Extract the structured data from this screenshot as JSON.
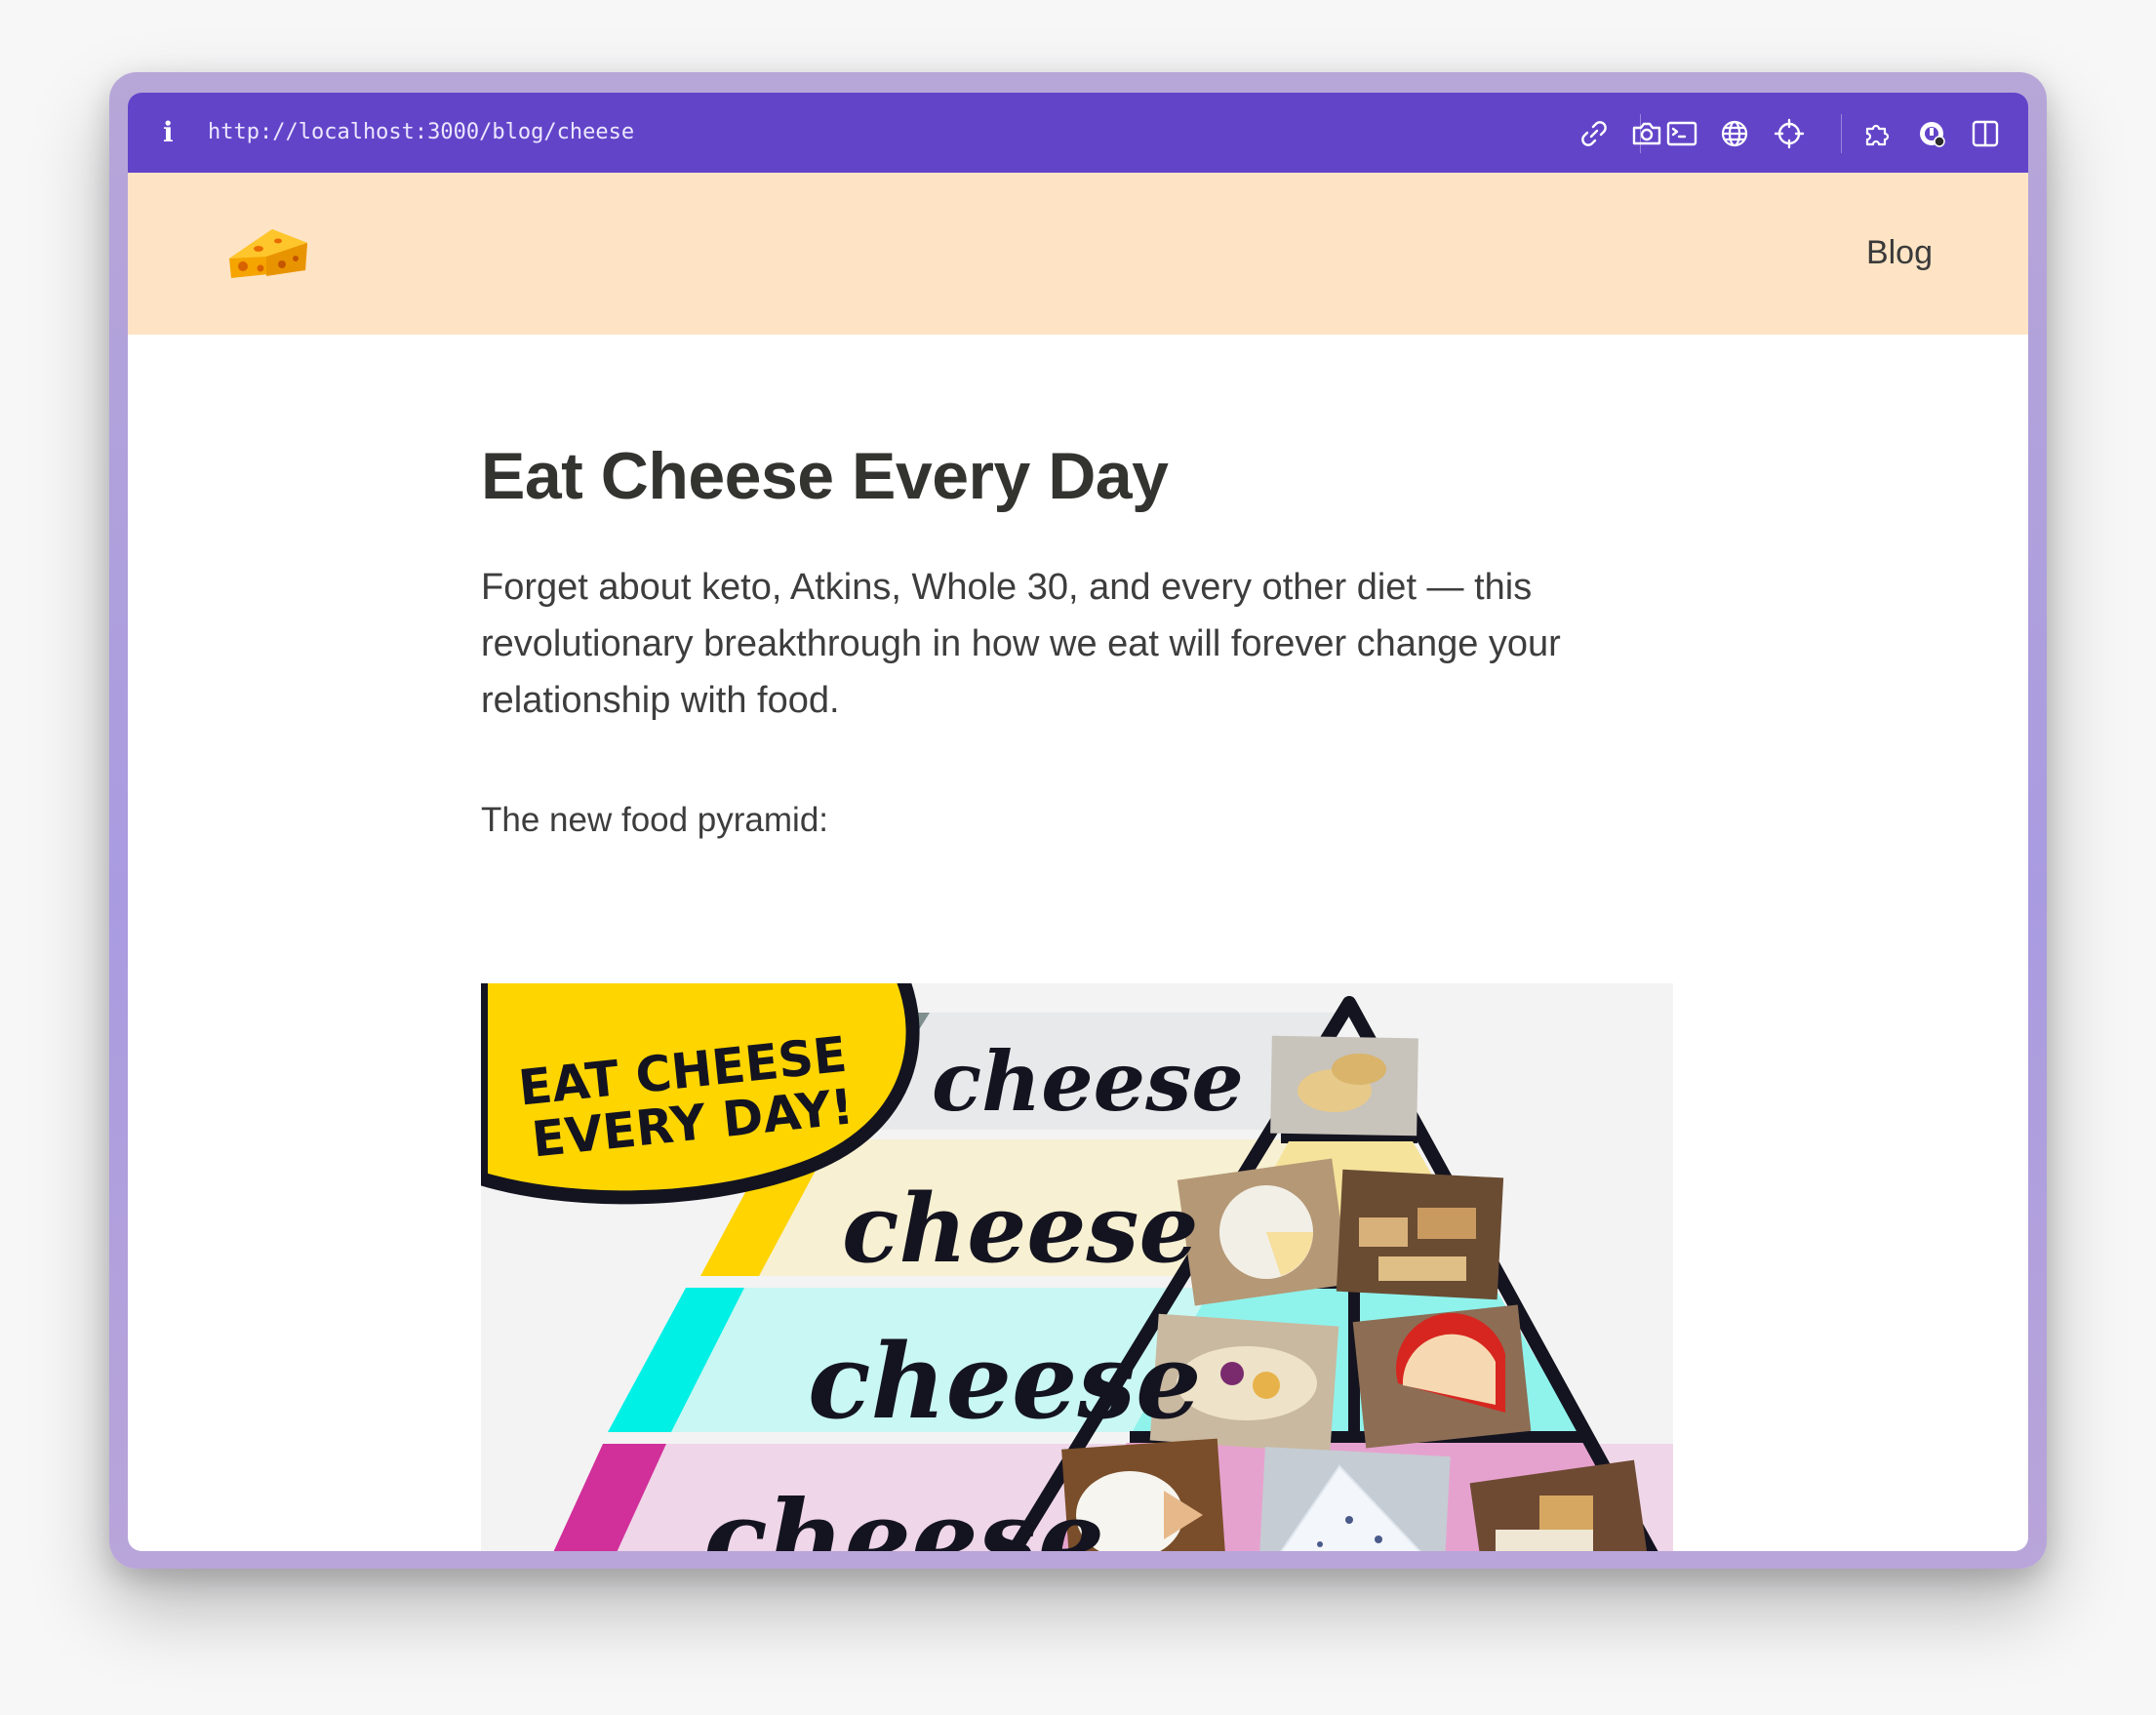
{
  "browser": {
    "url": "http://localhost:3000/blog/cheese",
    "toolbar_icons": [
      "link-icon",
      "camera-icon",
      "terminal-icon",
      "globe-icon",
      "crosshair-icon",
      "extension-icon",
      "devtools-icon",
      "split-view-icon"
    ]
  },
  "site": {
    "logo": "cheese-logo",
    "nav": {
      "blog_label": "Blog"
    }
  },
  "post": {
    "title": "Eat Cheese Every Day",
    "lead": "Forget about keto, Atkins, Whole 30, and every other diet — this revolutionary breakthrough in how we eat will forever change your relationship with food.",
    "pyramid_label": "The new food pyramid:",
    "pyramid": {
      "badge_line1": "EAT CHEESE",
      "badge_line2": "EVERY DAY!",
      "tiers": [
        "cheese",
        "cheese",
        "cheese",
        "cheese"
      ],
      "tier_colors": [
        "#e7e9ea",
        "#f7f0d2",
        "#c9f7f3",
        "#efd6e8"
      ],
      "stripe_colors": [
        "#7f8f8e",
        "#ffd400",
        "#00f0e6",
        "#d12f9a"
      ],
      "badge_color": "#ffd500"
    }
  }
}
